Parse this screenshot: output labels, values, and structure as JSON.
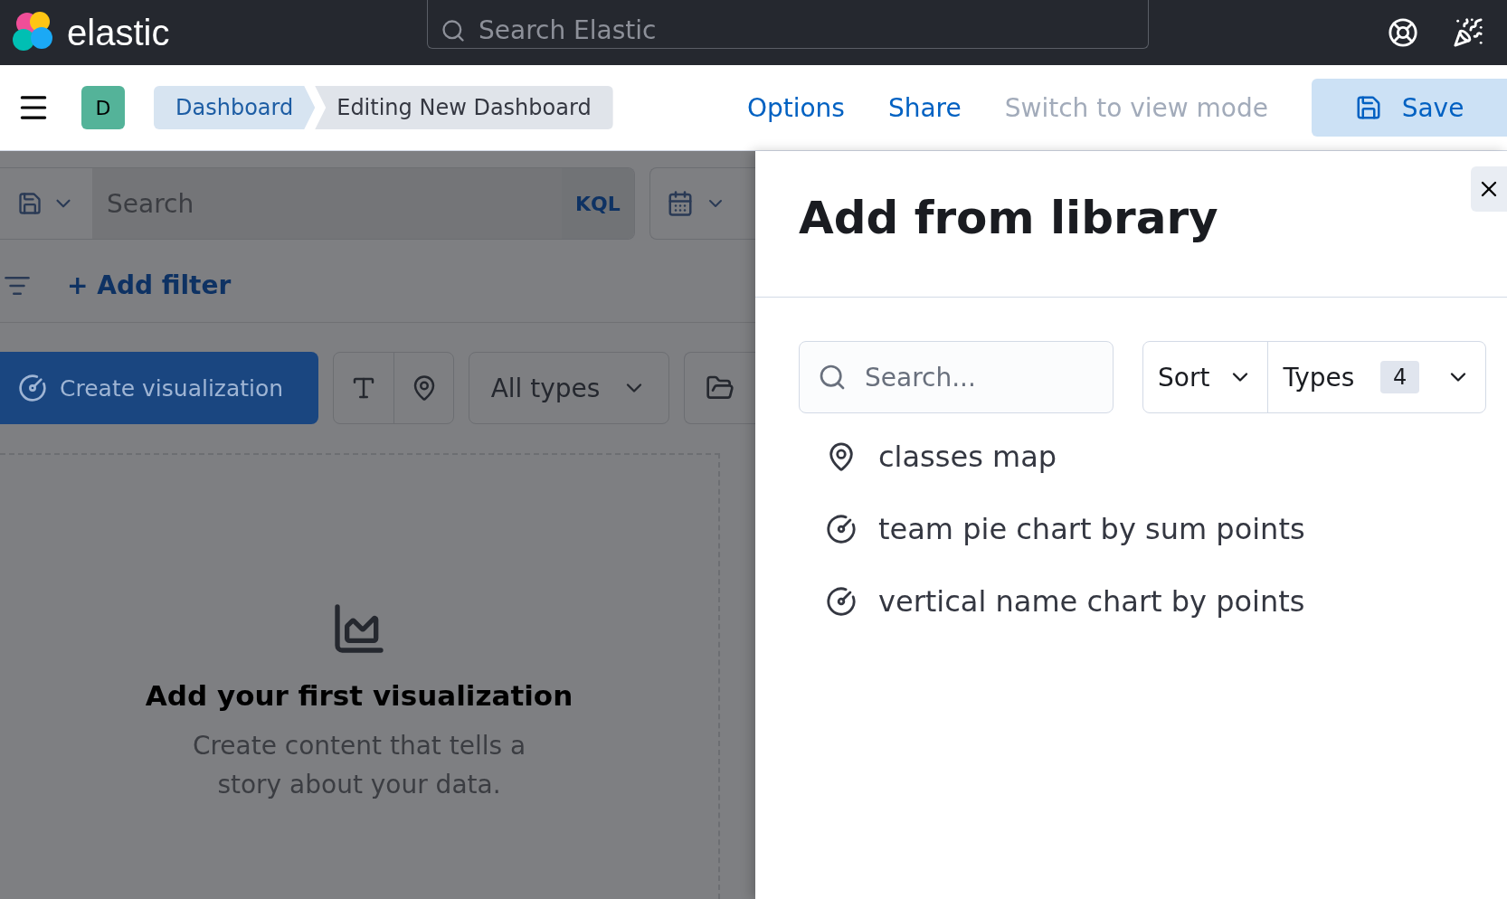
{
  "header": {
    "logo_text": "elastic",
    "search": {
      "placeholder": "Search Elastic"
    }
  },
  "subheader": {
    "avatar": "D",
    "breadcrumbs": [
      {
        "label": "Dashboard",
        "current": false
      },
      {
        "label": "Editing New Dashboard",
        "current": true
      }
    ],
    "links": [
      {
        "label": "Options",
        "disabled": false
      },
      {
        "label": "Share",
        "disabled": false
      },
      {
        "label": "Switch to view mode",
        "disabled": true
      }
    ],
    "save_button": "Save"
  },
  "query_bar": {
    "placeholder": "Search",
    "language": "KQL",
    "add_filter": "+ Add filter"
  },
  "toolbar": {
    "create_button": "Create visualization",
    "types_dropdown": "All types"
  },
  "empty_panel": {
    "title": "Add your first visualization",
    "description": "Create content that tells a story about your data."
  },
  "flyout": {
    "title": "Add from library",
    "search": {
      "placeholder": "Search..."
    },
    "sort": "Sort",
    "types": "Types",
    "types_count": "4",
    "items": [
      {
        "kind": "map",
        "label": "classes map"
      },
      {
        "kind": "visualization",
        "label": "team pie chart by sum points"
      },
      {
        "kind": "visualization",
        "label": "vertical name chart by points"
      }
    ]
  }
}
